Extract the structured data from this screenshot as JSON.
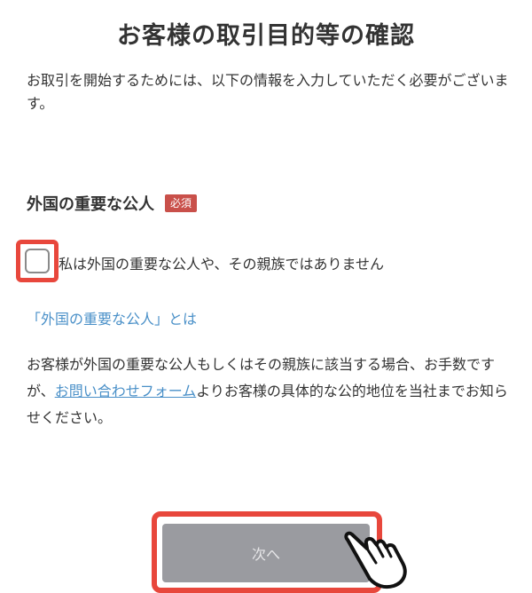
{
  "page": {
    "title": "お客様の取引目的等の確認",
    "intro": "お取引を開始するためには、以下の情報を入力していただく必要がございます。"
  },
  "pep_section": {
    "title": "外国の重要な公人",
    "required_badge": "必須",
    "checkbox_label": "私は外国の重要な公人や、その親族ではありません",
    "checkbox_checked": false,
    "info_link": "「外国の重要な公人」とは",
    "note_before": "お客様が外国の重要な公人もしくはその親族に該当する場合、お手数ですが、",
    "note_link": "お問い合わせフォーム",
    "note_after": "よりお客様の具体的な公的地位を当社までお知らせください。"
  },
  "footer": {
    "next_button": "次へ"
  },
  "colors": {
    "highlight": "#e8473c",
    "badge": "#c9504a",
    "link": "#4a90c8",
    "button_disabled": "#9a9ba0"
  },
  "icons": {
    "pointer": "pointing-hand-icon"
  }
}
